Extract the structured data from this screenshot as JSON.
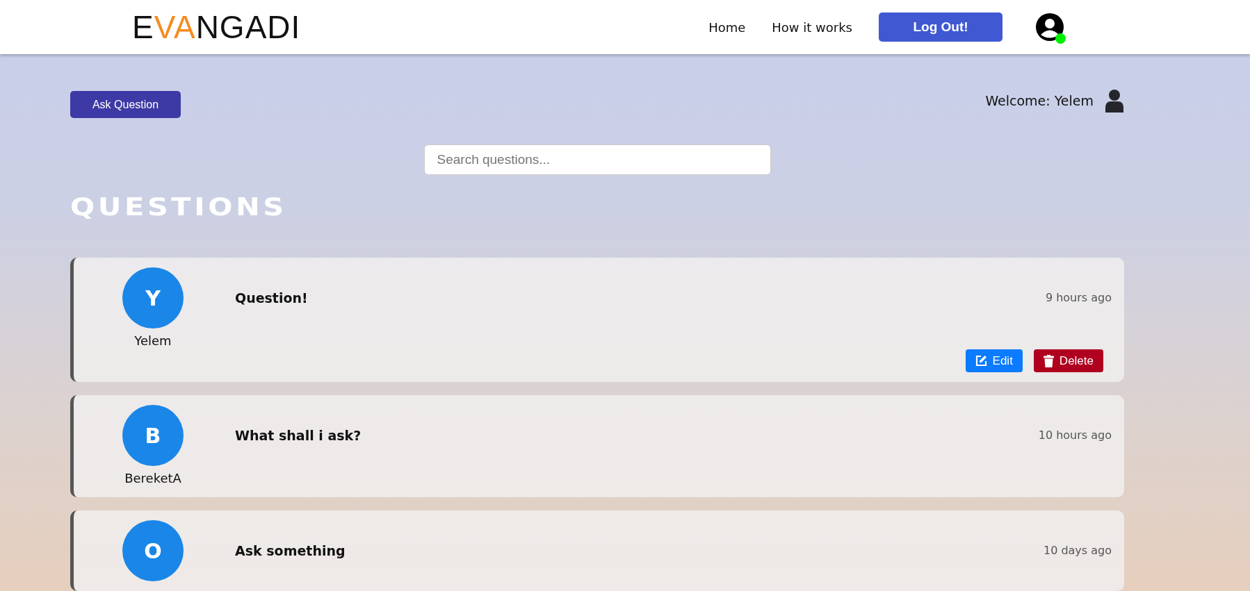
{
  "header": {
    "logo": [
      {
        "text": "E",
        "accent": false
      },
      {
        "text": "VA",
        "accent": true
      },
      {
        "text": "NGADI",
        "accent": false
      }
    ],
    "nav": [
      {
        "label": "Home"
      },
      {
        "label": "How it works"
      }
    ],
    "logout": "Log Out!",
    "online": true
  },
  "ask_button": "Ask Question",
  "welcome": "Welcome: Yelem",
  "search": {
    "placeholder": "Search questions..."
  },
  "heading": "QUESTIONS",
  "questions": [
    {
      "initial": "Y",
      "user": "Yelem",
      "title": "Question!",
      "time": "9 hours ago",
      "actions": [
        {
          "kind": "edit",
          "label": "Edit"
        },
        {
          "kind": "delete",
          "label": "Delete"
        }
      ]
    },
    {
      "initial": "B",
      "user": "BereketA",
      "title": "What shall i ask?",
      "time": "10 hours ago"
    },
    {
      "initial": "O",
      "title": "Ask something",
      "time": "10 days ago"
    }
  ]
}
